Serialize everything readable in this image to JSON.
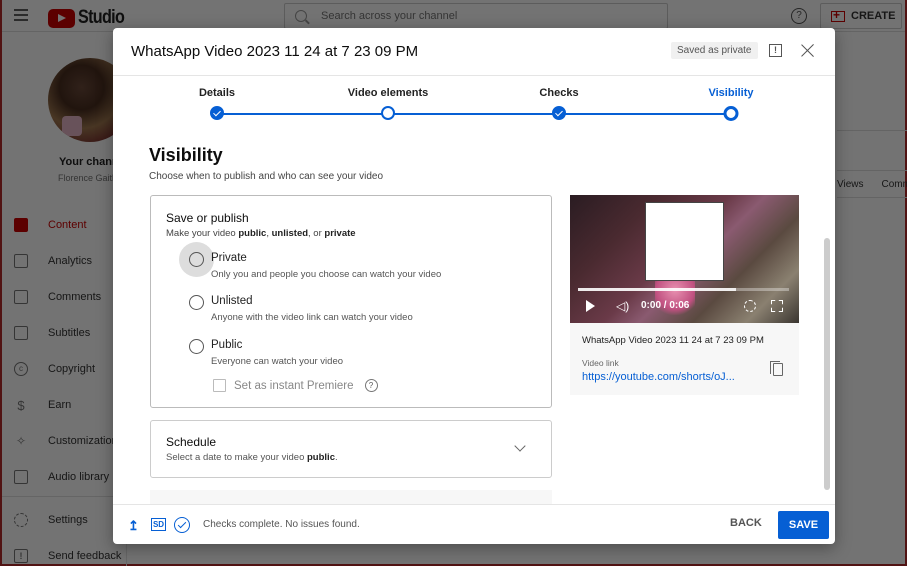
{
  "app": {
    "logo_text": "Studio",
    "search_placeholder": "Search across your channel",
    "help_glyph": "?",
    "create_label": "CREATE",
    "channel": {
      "label": "Your channel",
      "name": "Florence Gaith"
    },
    "nav": [
      {
        "label": "Content",
        "icon": "content-icon",
        "active": true
      },
      {
        "label": "Analytics",
        "icon": "analytics-icon"
      },
      {
        "label": "Comments",
        "icon": "comments-icon"
      },
      {
        "label": "Subtitles",
        "icon": "subtitles-icon"
      },
      {
        "label": "Copyright",
        "icon": "copyright-icon"
      },
      {
        "label": "Earn",
        "icon": "earn-icon"
      },
      {
        "label": "Customization",
        "icon": "customization-icon"
      },
      {
        "label": "Audio library",
        "icon": "audio-library-icon"
      },
      {
        "label": "Settings",
        "icon": "settings-icon"
      },
      {
        "label": "Send feedback",
        "icon": "feedback-icon"
      }
    ],
    "nav_glyphs": {
      "copyright": "c",
      "earn": "$",
      "customization": "✧",
      "feedback": "!"
    },
    "table_headers": [
      "Views",
      "Comm"
    ]
  },
  "dialog": {
    "title": "WhatsApp Video 2023 11 24 at 7 23 09 PM",
    "saved_badge": "Saved as private",
    "feedback_glyph": "!",
    "steps": [
      {
        "label": "Details",
        "state": "done"
      },
      {
        "label": "Video elements",
        "state": "pending"
      },
      {
        "label": "Checks",
        "state": "done"
      },
      {
        "label": "Visibility",
        "state": "current"
      }
    ],
    "visibility": {
      "title": "Visibility",
      "subtitle": "Choose when to publish and who can see your video"
    },
    "save_or_publish": {
      "title": "Save or publish",
      "subtitle_prefix": "Make your video ",
      "subtitle_public": "public",
      "subtitle_sep1": ", ",
      "subtitle_unlisted": "unlisted",
      "subtitle_sep2": ", or ",
      "subtitle_private": "private",
      "options": [
        {
          "label": "Private",
          "description": "Only you and people you choose can watch your video",
          "selected": false,
          "hovered": true
        },
        {
          "label": "Unlisted",
          "description": "Anyone with the video link can watch your video",
          "selected": false
        },
        {
          "label": "Public",
          "description": "Everyone can watch your video",
          "selected": false
        }
      ],
      "premiere_label": "Set as instant Premiere",
      "premiere_checked": false,
      "premiere_help_glyph": "?"
    },
    "schedule": {
      "title": "Schedule",
      "subtitle_prefix": "Select a date to make your video ",
      "subtitle_bold": "public",
      "subtitle_suffix": "."
    },
    "preview": {
      "time": "0:00 / 0:06",
      "buffered_fraction": 0.75,
      "volume_glyph": "◁)",
      "title": "WhatsApp Video 2023 11 24 at 7 23 09 PM",
      "link_label": "Video link",
      "link": "https://youtube.com/shorts/oJ..."
    },
    "footer": {
      "upload_glyph": "↥",
      "sd_label": "SD",
      "status": "Checks complete. No issues found.",
      "back_label": "BACK",
      "save_label": "SAVE"
    }
  }
}
